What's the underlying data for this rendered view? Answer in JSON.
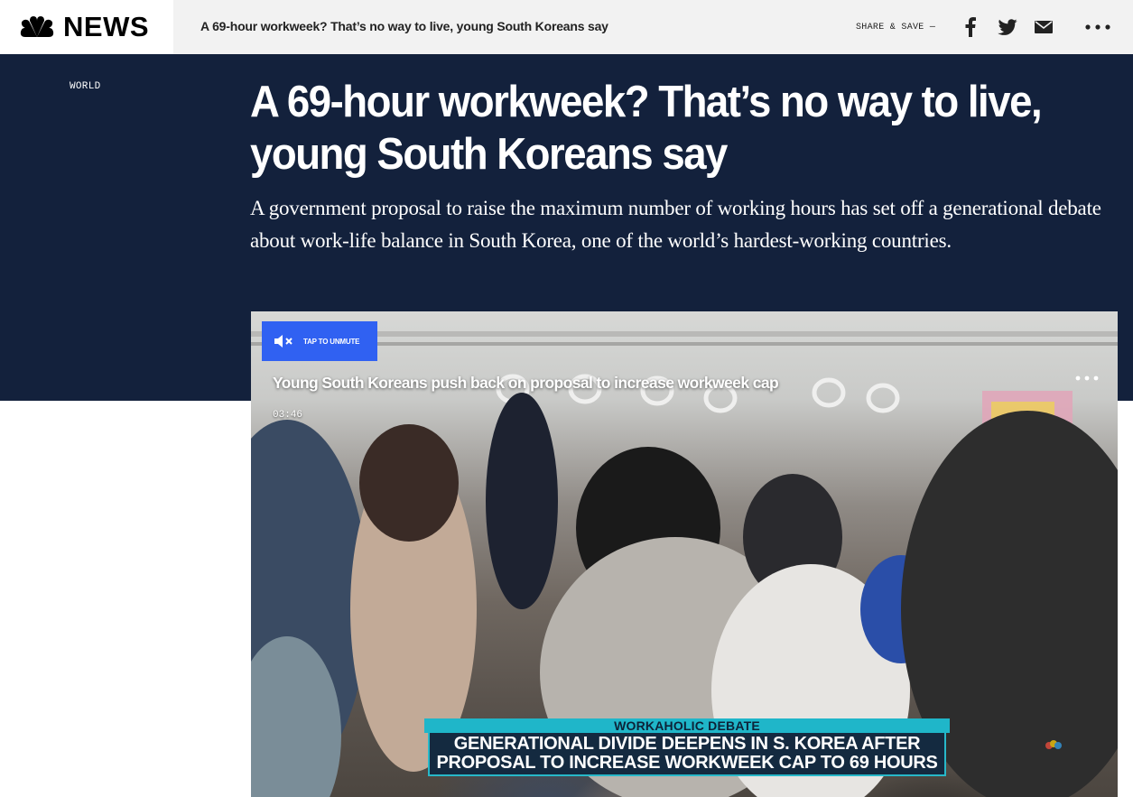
{
  "header": {
    "brand": "NEWS",
    "headline": "A 69-hour workweek? That’s no way to live, young South Koreans say",
    "share_label": "SHARE & SAVE —",
    "icons": [
      "nbc-peacock-logo",
      "facebook-icon",
      "twitter-icon",
      "mail-icon",
      "more-icon"
    ]
  },
  "article": {
    "section": "WORLD",
    "headline": "A 69-hour workweek? That’s no way to live, young South Koreans say",
    "dek": "A government proposal to raise the maximum number of working hours has set off a generational debate about work-life balance in South Korea, one of the world’s hardest-working countries."
  },
  "video": {
    "unmute_label": "TAP TO UNMUTE",
    "title": "Young South Koreans push back on proposal to increase workweek cap",
    "duration": "03:46",
    "chyron_kicker": "WORKAHOLIC DEBATE",
    "chyron_line1": "GENERATIONAL DIVIDE DEEPENS IN S. KOREA AFTER",
    "chyron_line2": "PROPOSAL TO INCREASE WORKWEEK CAP TO 69 HOURS"
  },
  "colors": {
    "hero_bg": "#13213c",
    "topbar_bg": "#f2f2f2",
    "unmute_blue": "#3061f2",
    "chyron_teal": "#1fb6c9",
    "chyron_navy": "#142a40"
  }
}
